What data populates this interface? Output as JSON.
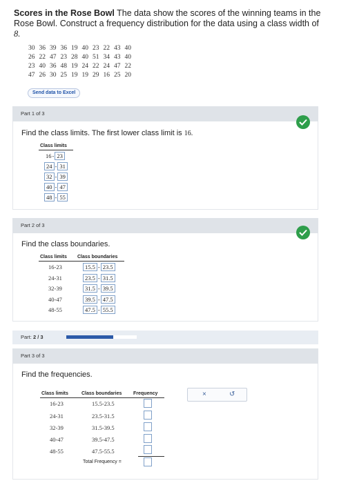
{
  "problem": {
    "title": "Scores in the Rose Bowl",
    "text": "The data show the scores of the winning teams in the Rose Bowl. Construct a frequency distribution for the data using a class width of",
    "class_width": "8."
  },
  "scores": [
    [
      "30",
      "36",
      "39",
      "36",
      "19",
      "40",
      "23",
      "22",
      "43",
      "40"
    ],
    [
      "26",
      "22",
      "47",
      "23",
      "28",
      "40",
      "51",
      "34",
      "43",
      "40"
    ],
    [
      "23",
      "40",
      "36",
      "48",
      "19",
      "24",
      "22",
      "24",
      "47",
      "22"
    ],
    [
      "47",
      "26",
      "30",
      "25",
      "19",
      "19",
      "29",
      "16",
      "25",
      "20"
    ]
  ],
  "send_excel_label": "Send data to Excel",
  "part1": {
    "header": "Part 1 of 3",
    "prompt": "Find the class limits. The first lower class limit is",
    "first_lower": "16.",
    "col_head": "Class limits",
    "rows": [
      {
        "lower": "16",
        "upper": "23"
      },
      {
        "lower": "24",
        "upper": "31"
      },
      {
        "lower": "32",
        "upper": "39"
      },
      {
        "lower": "40",
        "upper": "47"
      },
      {
        "lower": "48",
        "upper": "55"
      }
    ]
  },
  "part2": {
    "header": "Part 2 of 3",
    "prompt": "Find the class boundaries.",
    "col_limits": "Class limits",
    "col_boundaries": "Class boundaries",
    "rows": [
      {
        "limits": "16-23",
        "lower": "15.5",
        "upper": "23.5"
      },
      {
        "limits": "24-31",
        "lower": "23.5",
        "upper": "31.5"
      },
      {
        "limits": "32-39",
        "lower": "31.5",
        "upper": "39.5"
      },
      {
        "limits": "40-47",
        "lower": "39.5",
        "upper": "47.5"
      },
      {
        "limits": "48-55",
        "lower": "47.5",
        "upper": "55.5"
      }
    ]
  },
  "progress": {
    "label": "Part:",
    "value": "2 / 3",
    "fraction": 0.667
  },
  "part3": {
    "header": "Part 3 of 3",
    "prompt": "Find the frequencies.",
    "col_limits": "Class limits",
    "col_boundaries": "Class boundaries",
    "col_frequency": "Frequency",
    "rows": [
      {
        "limits": "16-23",
        "boundaries": "15.5-23.5",
        "frequency": ""
      },
      {
        "limits": "24-31",
        "boundaries": "23.5-31.5",
        "frequency": ""
      },
      {
        "limits": "32-39",
        "boundaries": "31.5-39.5",
        "frequency": ""
      },
      {
        "limits": "40-47",
        "boundaries": "39.5-47.5",
        "frequency": ""
      },
      {
        "limits": "48-55",
        "boundaries": "47.5-55.5",
        "frequency": ""
      }
    ],
    "total_label": "Total Frequency =",
    "total_value": ""
  },
  "tools": {
    "clear_icon": "×",
    "undo_icon": "↺"
  },
  "colors": {
    "check_green": "#2e9e4b",
    "progress_blue": "#2c5aa8",
    "input_border": "#7fa0c8"
  }
}
